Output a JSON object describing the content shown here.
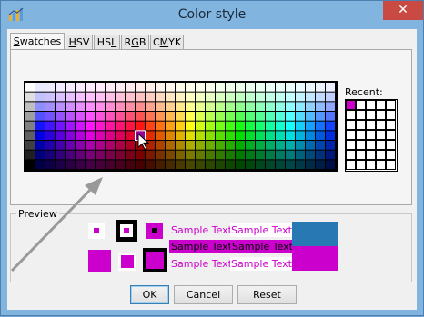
{
  "window": {
    "title": "Color style",
    "close_glyph": "✕",
    "app_icon": "color-chart-icon"
  },
  "tabs": [
    {
      "label": "Swatches",
      "mnemonic_index": 0,
      "active": true
    },
    {
      "label": "HSV",
      "mnemonic_index": 0,
      "active": false
    },
    {
      "label": "HSL",
      "mnemonic_index": 2,
      "active": false
    },
    {
      "label": "RGB",
      "mnemonic_index": 1,
      "active": false
    },
    {
      "label": "CMYK",
      "mnemonic_index": 1,
      "active": false
    }
  ],
  "swatches": {
    "selected_color": "#990099",
    "columns": 31,
    "rows": 9
  },
  "recent": {
    "label": "Recent:",
    "colors": [
      "#cc00cc"
    ],
    "columns": 5,
    "rows": 7
  },
  "preview": {
    "label": "Preview",
    "sample_text": "Sample Text",
    "foreground": "#cc00cc",
    "background": "#2878b4"
  },
  "buttons": {
    "ok": "OK",
    "cancel": "Cancel",
    "reset": "Reset"
  }
}
